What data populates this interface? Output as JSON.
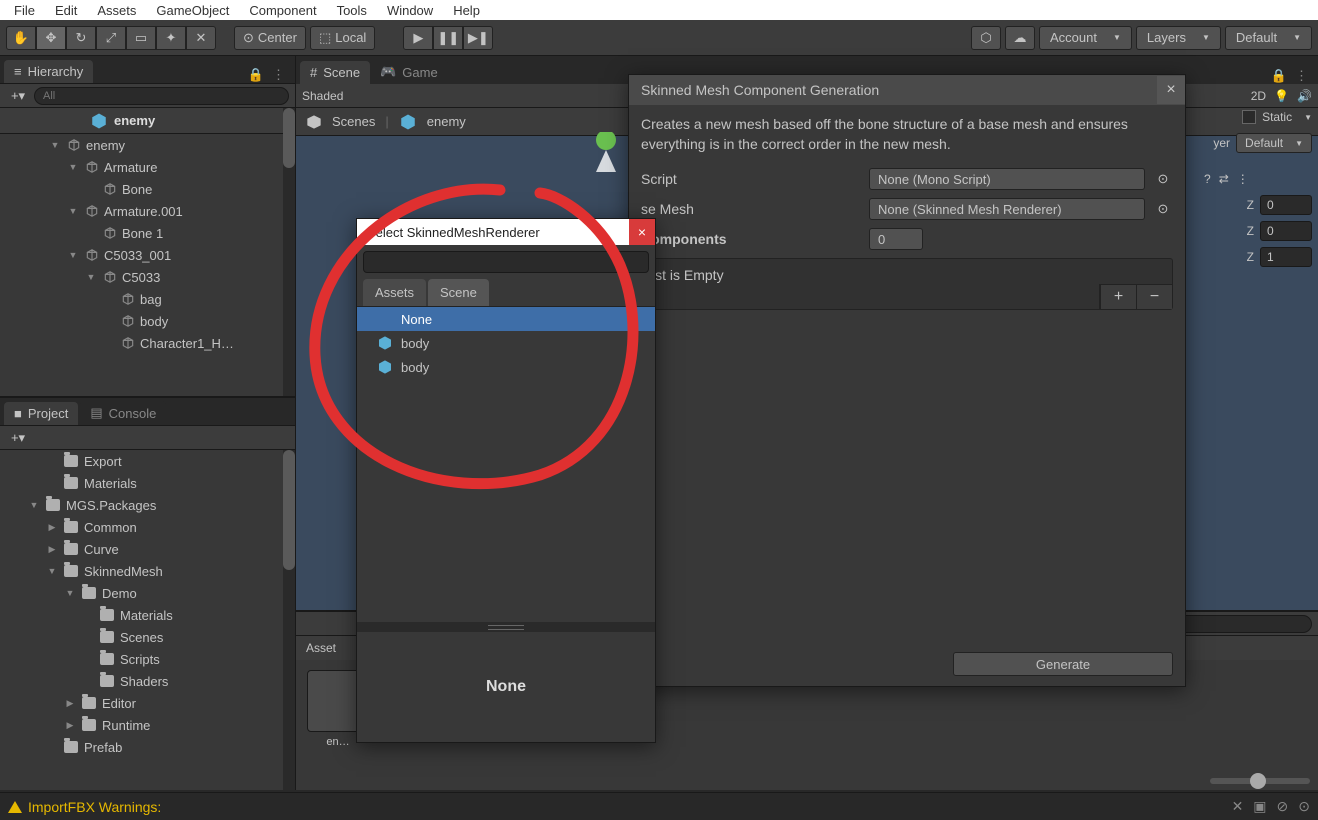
{
  "menu": [
    "File",
    "Edit",
    "Assets",
    "GameObject",
    "Component",
    "Tools",
    "Window",
    "Help"
  ],
  "toolbar": {
    "pivot": "Center",
    "handle": "Local",
    "account": "Account",
    "layers": "Layers",
    "layout": "Default"
  },
  "hierarchy": {
    "title": "Hierarchy",
    "search_placeholder": "All",
    "scene": "enemy",
    "rows": [
      {
        "indent": 1,
        "arrow": "▼",
        "label": "enemy"
      },
      {
        "indent": 2,
        "arrow": "▼",
        "label": "Armature"
      },
      {
        "indent": 3,
        "arrow": "",
        "label": "Bone"
      },
      {
        "indent": 2,
        "arrow": "▼",
        "label": "Armature.001"
      },
      {
        "indent": 3,
        "arrow": "",
        "label": "Bone 1"
      },
      {
        "indent": 2,
        "arrow": "▼",
        "label": "C5033_001"
      },
      {
        "indent": 3,
        "arrow": "▼",
        "label": "C5033"
      },
      {
        "indent": 4,
        "arrow": "",
        "label": "bag"
      },
      {
        "indent": 4,
        "arrow": "",
        "label": "body"
      },
      {
        "indent": 4,
        "arrow": "",
        "label": "Character1_H…"
      }
    ]
  },
  "project": {
    "title_project": "Project",
    "title_console": "Console",
    "rows": [
      {
        "indent": 2,
        "arrow": "",
        "label": "Export"
      },
      {
        "indent": 2,
        "arrow": "",
        "label": "Materials"
      },
      {
        "indent": 1,
        "arrow": "▼",
        "label": "MGS.Packages"
      },
      {
        "indent": 2,
        "arrow": "▶",
        "label": "Common"
      },
      {
        "indent": 2,
        "arrow": "▶",
        "label": "Curve"
      },
      {
        "indent": 2,
        "arrow": "▼",
        "label": "SkinnedMesh"
      },
      {
        "indent": 3,
        "arrow": "▼",
        "label": "Demo"
      },
      {
        "indent": 4,
        "arrow": "",
        "label": "Materials"
      },
      {
        "indent": 4,
        "arrow": "",
        "label": "Scenes"
      },
      {
        "indent": 4,
        "arrow": "",
        "label": "Scripts"
      },
      {
        "indent": 4,
        "arrow": "",
        "label": "Shaders"
      },
      {
        "indent": 3,
        "arrow": "▶",
        "label": "Editor"
      },
      {
        "indent": 3,
        "arrow": "▶",
        "label": "Runtime"
      },
      {
        "indent": 2,
        "arrow": "",
        "label": "Prefab"
      }
    ]
  },
  "scene": {
    "tab_scene": "Scene",
    "tab_game": "Game",
    "shading": "Shaded",
    "mode2d": "2D",
    "bc_scenes": "Scenes",
    "bc_enemy": "enemy",
    "asset_header": "Asset",
    "asset_item": "en…"
  },
  "inspector": {
    "static_label": "Static",
    "layer_dd": "Default",
    "z_rows": [
      {
        "axis": "Z",
        "val": "0"
      },
      {
        "axis": "Z",
        "val": "0"
      },
      {
        "axis": "Z",
        "val": "1"
      }
    ],
    "rightpanel_layer_word": "yer"
  },
  "picker": {
    "title": "Select SkinnedMeshRenderer",
    "tabs": [
      "Assets",
      "Scene"
    ],
    "items": [
      {
        "label": "None",
        "sel": true,
        "icon": false
      },
      {
        "label": "body",
        "sel": false,
        "icon": true
      },
      {
        "label": "body",
        "sel": false,
        "icon": true
      }
    ],
    "preview": "None"
  },
  "comp": {
    "title": "Skinned Mesh Component Generation",
    "desc": "Creates a new mesh based off the bone structure of a base mesh and ensures everything is in the correct order in the new mesh.",
    "script_label": "Script",
    "script_value": "None (Mono Script)",
    "base_label": "se Mesh",
    "base_value": "None (Skinned Mesh Renderer)",
    "components_label": "Components",
    "components_count": "0",
    "list_empty": "ist is Empty",
    "generate": "Generate"
  },
  "status": {
    "text": "ImportFBX Warnings:"
  }
}
